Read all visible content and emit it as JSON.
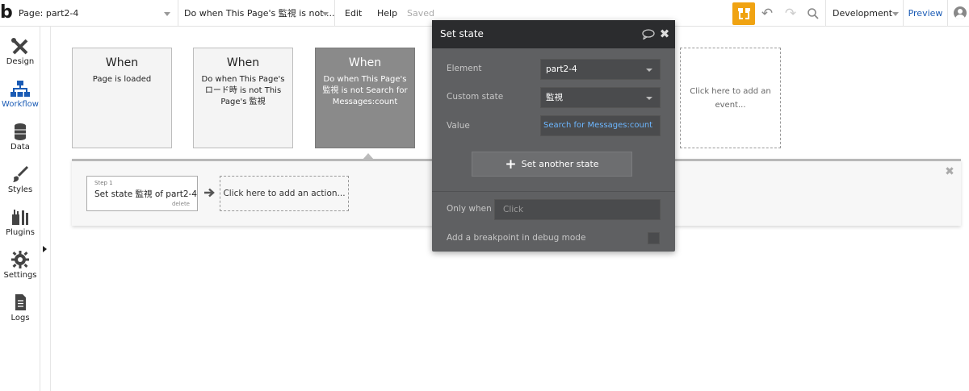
{
  "topbar": {
    "logo": "b",
    "page_select": "Page: part2-4",
    "event_select": "Do when This Page's 監視 is not ...",
    "menu": {
      "edit": "Edit",
      "help": "Help",
      "saved": "Saved"
    },
    "gift_icon": "gift-icon",
    "undo_icon": "↶",
    "redo_icon": "↷",
    "search_icon": "⚲",
    "environment": "Development",
    "preview": "Preview",
    "accent_color": "#f0a312",
    "link_color": "#1a5bb5"
  },
  "sidebar": {
    "items": [
      {
        "label": "Design",
        "icon": "design-icon"
      },
      {
        "label": "Workflow",
        "icon": "workflow-icon",
        "active": true
      },
      {
        "label": "Data",
        "icon": "database-icon"
      },
      {
        "label": "Styles",
        "icon": "brush-icon"
      },
      {
        "label": "Plugins",
        "icon": "plugin-icon"
      },
      {
        "label": "Settings",
        "icon": "gear-icon"
      },
      {
        "label": "Logs",
        "icon": "document-icon"
      }
    ]
  },
  "events": [
    {
      "when": "When",
      "desc": "Page is loaded"
    },
    {
      "when": "When",
      "desc": "Do when This Page's ロード時 is not This Page's 監視"
    },
    {
      "when": "When",
      "desc": "Do when This Page's 監視 is not Search for Messages:count",
      "selected": true
    }
  ],
  "add_event": "Click here to add an event...",
  "actions": {
    "step_number": "Step 1",
    "step_title": "Set state 監視 of part2-4",
    "delete_label": "delete",
    "add_action": "Click here to add an action...",
    "close_icon": "✖"
  },
  "panel": {
    "title": "Set state",
    "element_label": "Element",
    "element_value": "part2-4",
    "custom_state_label": "Custom state",
    "custom_state_value": "監視",
    "value_label": "Value",
    "value_value": "Search for Messages:count",
    "set_another": "Set another state",
    "only_when_label": "Only when",
    "only_when_placeholder": "Click",
    "breakpoint_label": "Add a breakpoint in debug mode",
    "panel_color": "#5f6062",
    "header_color": "#2b2c2e",
    "expression_color": "#6db7ff"
  }
}
